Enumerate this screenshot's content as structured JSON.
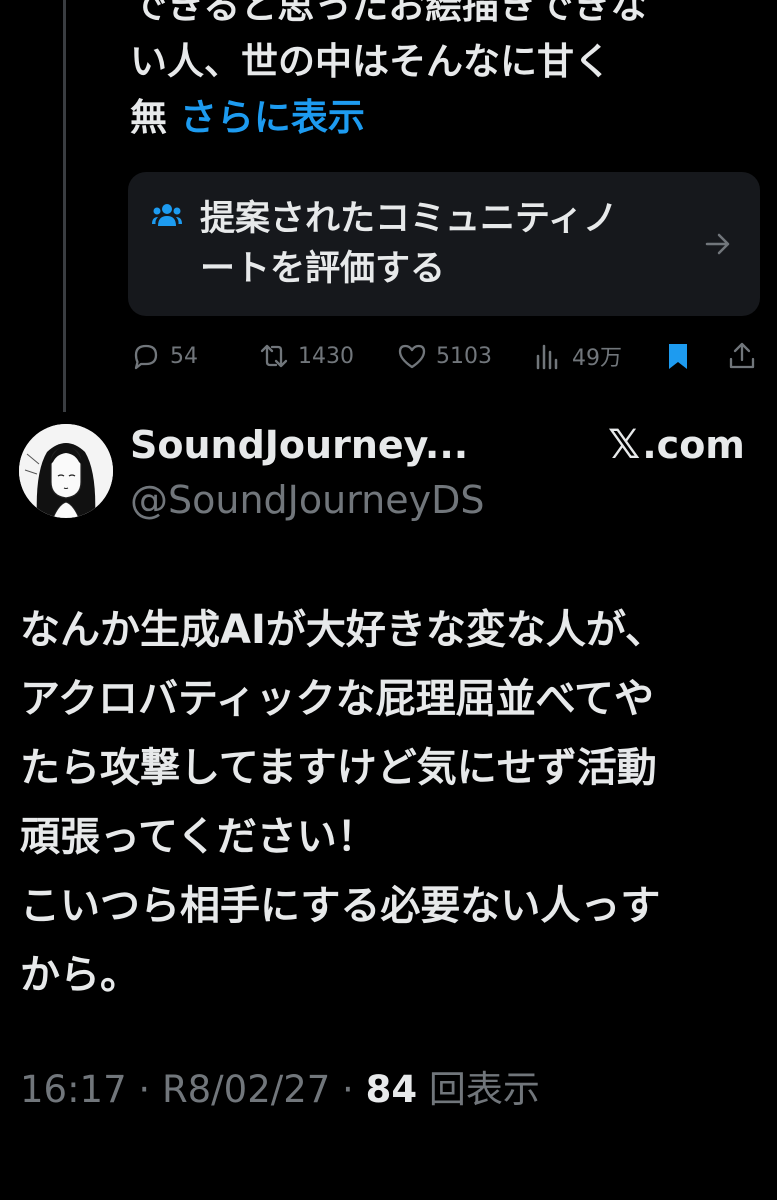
{
  "previous_tweet": {
    "text_lines": [
      "できると思ったお絵描きできな",
      "い人、世の中はそんなに甘く",
      "無"
    ],
    "show_more": "さらに表示",
    "community_note": {
      "label_line1": "提案されたコミュニティノ",
      "label_line2": "ートを評価する",
      "icon": "people-icon"
    },
    "actions": {
      "replies": "54",
      "reposts": "1430",
      "likes": "5103",
      "views": "49万"
    }
  },
  "tweet": {
    "author_name": "SoundJourney...",
    "author_handle": "@SoundJourneyDS",
    "source": ".com",
    "source_icon": "x-logo-icon",
    "body_lines": [
      "なんか生成AIが大好きな変な人が、",
      "アクロバティックな屁理屈並べてや",
      "たら攻撃してますけど気にせず活動",
      "頑張ってください！",
      "こいつら相手にする必要ない人っす",
      "から。"
    ],
    "time": "16:17",
    "date": "R8/02/27",
    "view_count": "84",
    "view_label": "回表示"
  },
  "colors": {
    "background": "#000000",
    "text": "#e7e9ea",
    "secondary": "#71767b",
    "accent": "#1d9bf0",
    "card": "#16181c"
  }
}
